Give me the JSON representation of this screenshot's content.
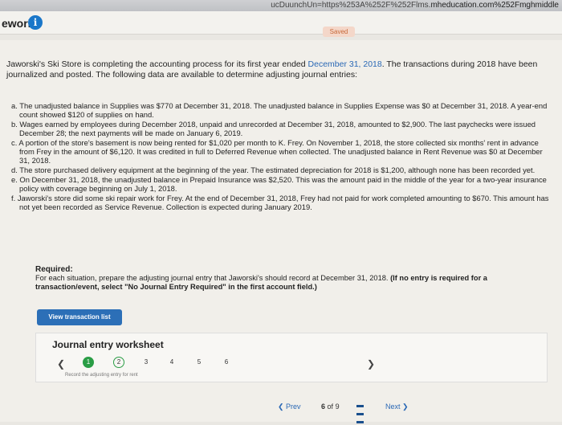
{
  "browser": {
    "url_prefix": "ucDuunchUn=https%253A%252F%252Flms.",
    "url_domain": "mheducation.com%252Fmghmiddle"
  },
  "header": {
    "title": "ework",
    "saved_label": "Saved"
  },
  "intro": {
    "part1": "Jaworski's Ski Store is completing the accounting process for its first year ended ",
    "date": "December 31, 2018",
    "part2": ". The transactions during 2018 have been journalized and posted. The following data are available to determine adjusting journal entries:"
  },
  "items": [
    "a. The unadjusted balance in Supplies was $770 at December 31, 2018. The unadjusted balance in Supplies Expense was $0 at December 31, 2018. A year-end count showed $120 of supplies on hand.",
    "b. Wages earned by employees during December 2018, unpaid and unrecorded at December 31, 2018, amounted to $2,900. The last paychecks were issued December 28; the next payments will be made on January 6, 2019.",
    "c. A portion of the store's basement is now being rented for $1,020 per month to K. Frey. On November 1, 2018, the store collected six months' rent in advance from Frey in the amount of $6,120. It was credited in full to Deferred Revenue when collected. The unadjusted balance in Rent Revenue was $0 at December 31, 2018.",
    "d. The store purchased delivery equipment at the beginning of the year. The estimated depreciation for 2018 is $1,200, although none has been recorded yet.",
    "e. On December 31, 2018, the unadjusted balance in Prepaid Insurance was $2,520. This was the amount paid in the middle of the year for a two-year insurance policy with coverage beginning on July 1, 2018.",
    "f. Jaworski's store did some ski repair work for Frey. At the end of December 31, 2018, Frey had not paid for work completed amounting to $670. This amount has not yet been recorded as Service Revenue. Collection is expected during January 2019."
  ],
  "required": {
    "label": "Required:",
    "text": "For each situation, prepare the adjusting journal entry that Jaworski's should record at December 31, 2018. ",
    "bold": "(If no entry is required for a transaction/event, select \"No Journal Entry Required\" in the first account field.)"
  },
  "view_button": "View transaction list",
  "worksheet": {
    "title": "Journal entry worksheet",
    "steps": [
      "1",
      "2",
      "3",
      "4",
      "5",
      "6"
    ],
    "hint": "Record the adjusting entry for rent"
  },
  "nav": {
    "prev": "Prev",
    "page": "6",
    "of": "of",
    "total": "9",
    "next": "Next"
  }
}
